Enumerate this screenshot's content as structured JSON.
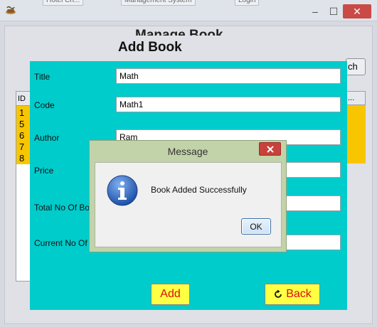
{
  "window": {
    "bg_tab_1": "Hotel Ch...",
    "bg_tab_2": "Management System",
    "bg_tab_3": "Login"
  },
  "manage": {
    "title": "Manage Book",
    "table_header": "ID",
    "table_ids": [
      "1",
      "5",
      "6",
      "7",
      "8"
    ],
    "search_button_partial": "ch",
    "right_header": "..."
  },
  "add_book": {
    "title": "Add Book",
    "fields": {
      "title": {
        "label": "Title",
        "value": "Math"
      },
      "code": {
        "label": "Code",
        "value": "Math1"
      },
      "author": {
        "label": "Author",
        "value": "Ram"
      },
      "price": {
        "label": "Price",
        "value": ""
      },
      "total": {
        "label": "Total No Of Books",
        "value": ""
      },
      "current": {
        "label": "Current No Of Books",
        "value": ""
      }
    },
    "add_button": "Add",
    "back_button": "Back"
  },
  "dialog": {
    "title": "Message",
    "message": "Book Added Successfully",
    "ok_label": "OK"
  },
  "colors": {
    "panel": "#00cccc",
    "button_yellow": "#ffff44",
    "button_text": "#d81010",
    "table_highlight": "#f7c600",
    "close_red": "#c94a46"
  }
}
